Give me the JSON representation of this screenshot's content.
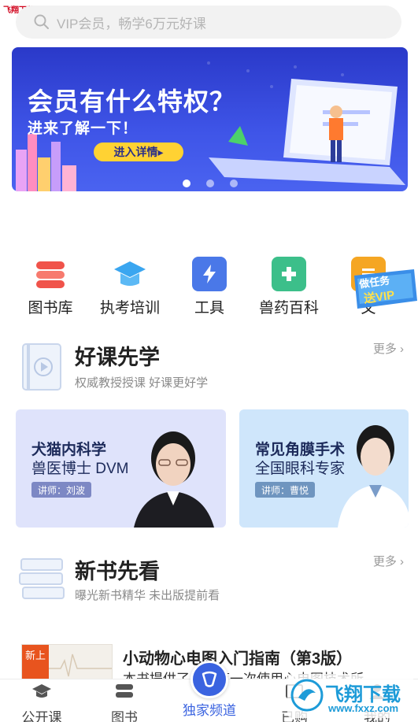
{
  "watermark_top": "飞翔下载 www.FXXZ.com",
  "search": {
    "placeholder": "VIP会员，畅学6万元好课"
  },
  "banner": {
    "title": "会员有什么特权？",
    "subtitle": "进来了解一下！",
    "cta": "进入详情▸",
    "dots": 3,
    "active_dot": 1
  },
  "categories": [
    {
      "label": "图书库",
      "icon": "books-icon",
      "color": "#f0534a"
    },
    {
      "label": "执考培训",
      "icon": "graduation-cap-icon",
      "color": "#3aa6f0"
    },
    {
      "label": "工具",
      "icon": "lightning-icon",
      "color": "#4a78e8"
    },
    {
      "label": "兽药百科",
      "icon": "medical-kit-icon",
      "color": "#3cbf8a"
    },
    {
      "label": "文",
      "icon": "document-icon",
      "color": "#f5a623"
    }
  ],
  "vip_badge": {
    "line1": "做任务",
    "line2": "送VIP"
  },
  "section_courses": {
    "title": "好课先学",
    "desc": "权威教授授课 好课更好学",
    "more": "更多",
    "cards": [
      {
        "title": "犬猫内科学",
        "subtitle": "兽医博士 DVM",
        "teacher": "讲师：刘波"
      },
      {
        "title": "常见角膜手术",
        "subtitle": "全国眼科专家",
        "teacher": "讲师：曹悦"
      }
    ]
  },
  "section_books": {
    "title": "新书先看",
    "desc": "曝光新书精华 未出版提前看",
    "more": "更多",
    "book": {
      "tag": "新上",
      "title": "小动物心电图入门指南（第3版）",
      "desc": "本书提供了……第一次使用心电图技术所"
    }
  },
  "tabbar": {
    "items": [
      {
        "label": "公开课",
        "icon": "open-course-icon"
      },
      {
        "label": "图书",
        "icon": "book-icon"
      },
      {
        "label": "独家频道",
        "icon": "exclusive-channel-icon",
        "active": true
      },
      {
        "label": "已购",
        "icon": "purchased-icon"
      },
      {
        "label": "我的",
        "icon": "profile-icon"
      }
    ]
  },
  "watermark_bottom": {
    "text": "飞翔下载",
    "url": "www.fxxz.com"
  },
  "colors": {
    "accent": "#3a63e0",
    "banner": "#3f55e8",
    "cta": "#ffd233"
  }
}
